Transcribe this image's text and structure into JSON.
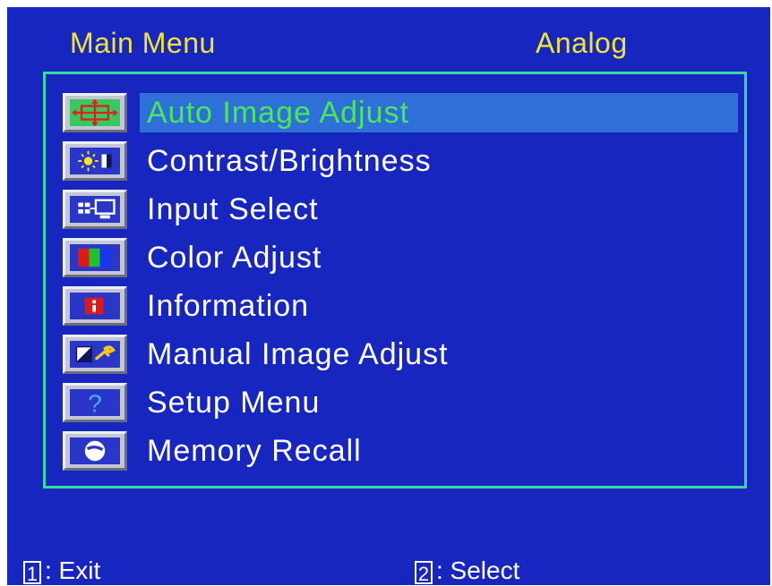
{
  "header": {
    "title": "Main Menu",
    "signal": "Analog"
  },
  "menu": {
    "selected_index": 0,
    "items": [
      {
        "label": "Auto Image Adjust",
        "icon": "auto-adjust-icon"
      },
      {
        "label": "Contrast/Brightness",
        "icon": "contrast-brightness-icon"
      },
      {
        "label": "Input Select",
        "icon": "input-select-icon"
      },
      {
        "label": "Color Adjust",
        "icon": "color-adjust-icon"
      },
      {
        "label": "Information",
        "icon": "information-icon"
      },
      {
        "label": "Manual Image Adjust",
        "icon": "manual-adjust-icon"
      },
      {
        "label": "Setup Menu",
        "icon": "setup-menu-icon"
      },
      {
        "label": "Memory Recall",
        "icon": "memory-recall-icon"
      }
    ]
  },
  "footer": {
    "exit_key": "1",
    "exit_label": ": Exit",
    "select_key": "2",
    "select_label": ": Select"
  },
  "colors": {
    "background": "#1826c0",
    "title": "#f4e430",
    "frame": "#38d8a0",
    "highlight": "#2f6fd8",
    "selected_text": "#48e85c",
    "text": "#ffffff"
  }
}
